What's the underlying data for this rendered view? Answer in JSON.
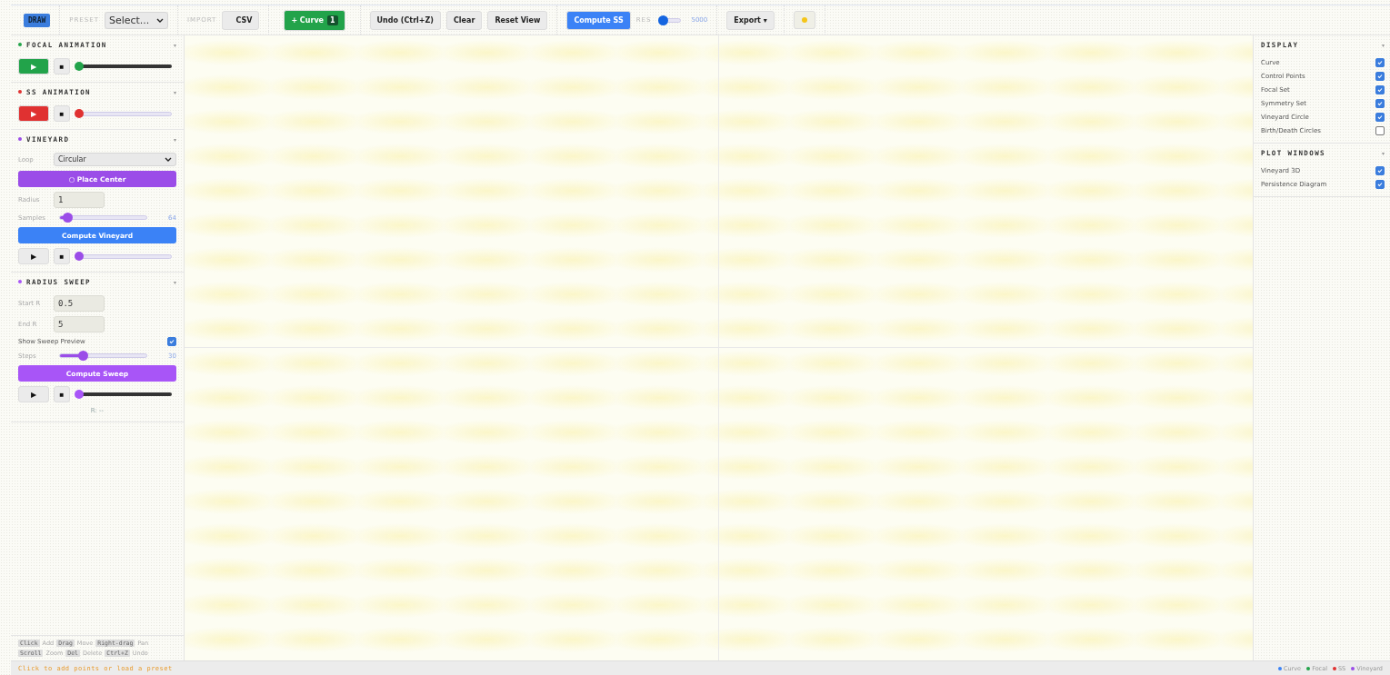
{
  "toolbar": {
    "mode": "DRAW",
    "preset": {
      "label": "PRESET",
      "value": "Select..."
    },
    "import": {
      "label": "IMPORT",
      "button": "CSV"
    },
    "curve": {
      "label": "+ Curve",
      "count": "1"
    },
    "buttons": [
      "Undo (Ctrl+Z)",
      "Clear",
      "Reset View"
    ],
    "compute": "Compute SS",
    "res": {
      "label": "RES",
      "level": 0.05,
      "reading": "5000"
    },
    "export": "Export ▾"
  },
  "left_sections": [
    {
      "title": "FOCAL ANIMATION",
      "color": "#22a34a",
      "caret": "▾",
      "controls": [
        {
          "kind": "player",
          "play": "▶",
          "stop": "■",
          "filled": true,
          "color": "#22a34a",
          "dark": true,
          "level": 0
        }
      ]
    },
    {
      "title": "SS ANIMATION",
      "color": "#e03131",
      "caret": "▾",
      "controls": [
        {
          "kind": "player",
          "play": "▶",
          "stop": "■",
          "filled": true,
          "color": "#e03131",
          "dark": false,
          "level": 0
        }
      ]
    },
    {
      "title": "VINEYARD",
      "color": "#9b4de8",
      "caret": "▾",
      "controls": [
        {
          "kind": "select",
          "label": "Loop",
          "value": "Circular"
        },
        {
          "kind": "button",
          "label": "○ Place Center",
          "color": "#9b4de8"
        },
        {
          "kind": "field",
          "label": "Radius",
          "value": "1"
        },
        {
          "kind": "slider",
          "label": "Samples",
          "level": 0.1,
          "reading": "64"
        },
        {
          "kind": "button",
          "label": "Compute Vineyard",
          "color": "#3b82f6"
        },
        {
          "kind": "player",
          "play": "▶",
          "stop": "■",
          "filled": false,
          "color": "#9b4de8",
          "dark": false,
          "level": 0
        }
      ]
    },
    {
      "title": "RADIUS SWEEP",
      "color": "#a855f7",
      "caret": "▾",
      "controls": [
        {
          "kind": "field",
          "label": "Start R",
          "value": "0.5"
        },
        {
          "kind": "field",
          "label": "End R",
          "value": "5"
        },
        {
          "kind": "checkbox",
          "label": "Show Sweep Preview",
          "checked": true
        },
        {
          "kind": "slider",
          "label": "Steps",
          "level": 0.28,
          "reading": "30"
        },
        {
          "kind": "button",
          "label": "Compute Sweep",
          "color": "#a855f7"
        },
        {
          "kind": "player",
          "play": "▶",
          "stop": "■",
          "filled": false,
          "color": "#a855f7",
          "dark": true,
          "level": 0
        },
        {
          "kind": "readout",
          "text": "R: --"
        }
      ]
    }
  ],
  "help": [
    [
      {
        "key": "Click",
        "action": "Add"
      },
      {
        "key": "Drag",
        "action": "Move"
      },
      {
        "key": "Right-drag",
        "action": "Pan"
      }
    ],
    [
      {
        "key": "Scroll",
        "action": "Zoom"
      },
      {
        "key": "Del",
        "action": "Delete"
      },
      {
        "key": "Ctrl+Z",
        "action": "Undo"
      }
    ]
  ],
  "right_sections": [
    {
      "title": "DISPLAY",
      "caret": "▾",
      "items": [
        {
          "label": "Curve",
          "checked": true
        },
        {
          "label": "Control Points",
          "checked": true
        },
        {
          "label": "Focal Set",
          "checked": true
        },
        {
          "label": "Symmetry Set",
          "checked": true
        },
        {
          "label": "Vineyard Circle",
          "checked": true
        },
        {
          "label": "Birth/Death Circles",
          "checked": false
        }
      ]
    },
    {
      "title": "PLOT WINDOWS",
      "caret": "▾",
      "items": [
        {
          "label": "Vineyard 3D",
          "checked": true
        },
        {
          "label": "Persistence Diagram",
          "checked": true
        }
      ]
    }
  ],
  "status_bar": {
    "message": "Click to add points or load a preset",
    "legend": [
      {
        "label": "Curve",
        "color": "#3b82f6"
      },
      {
        "label": "Focal",
        "color": "#22a34a"
      },
      {
        "label": "SS",
        "color": "#e03131"
      },
      {
        "label": "Vineyard",
        "color": "#9b4de8"
      }
    ]
  }
}
